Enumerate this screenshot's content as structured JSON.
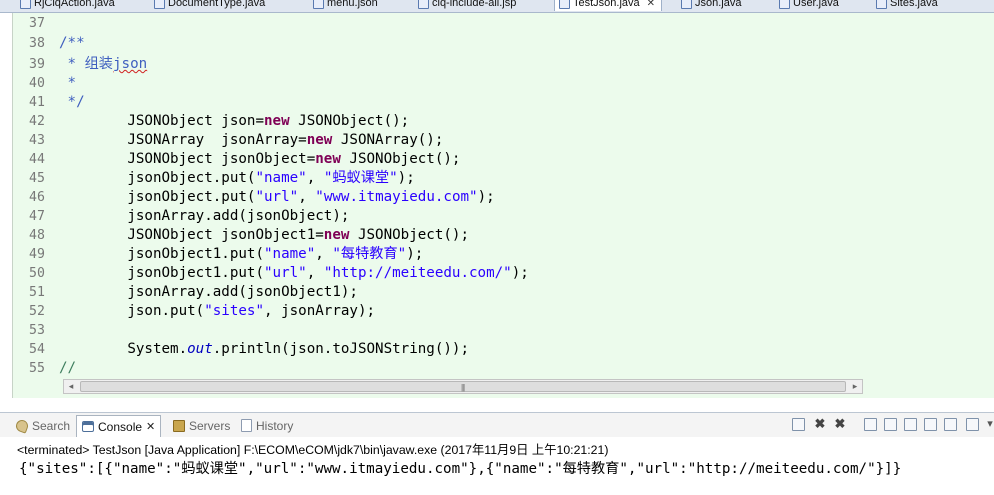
{
  "editor_tabs": [
    {
      "label": "RjCiqAction.java",
      "active": false
    },
    {
      "label": "DocumentType.java",
      "active": false
    },
    {
      "label": "menu.json",
      "active": false
    },
    {
      "label": "ciq-include-all.jsp",
      "active": false
    },
    {
      "label": "TestJson.java",
      "active": true,
      "close": "✕"
    },
    {
      "label": "Json.java",
      "active": false
    },
    {
      "label": "User.java",
      "active": false
    },
    {
      "label": "Sites.java",
      "active": false
    }
  ],
  "code": {
    "lines": [
      {
        "num": "37",
        "text": ""
      },
      {
        "num": "38",
        "text": "/**"
      },
      {
        "num": "39",
        "prefix": " * 组装",
        "word": "json"
      },
      {
        "num": "40",
        "text": " *"
      },
      {
        "num": "41",
        "text": " */"
      },
      {
        "num": "42",
        "a": "        JSONObject json=",
        "kw": "new",
        "b": " JSONObject();"
      },
      {
        "num": "43",
        "a": "        JSONArray  jsonArray=",
        "kw": "new",
        "b": " JSONArray();"
      },
      {
        "num": "44",
        "a": "        JSONObject jsonObject=",
        "kw": "new",
        "b": " JSONObject();"
      },
      {
        "num": "45",
        "a": "        jsonObject.put(",
        "s1": "\"name\"",
        "m": ", ",
        "s2": "\"蚂蚁课堂\"",
        "b": ");"
      },
      {
        "num": "46",
        "a": "        jsonObject.put(",
        "s1": "\"url\"",
        "m": ", ",
        "s2": "\"www.itmayiedu.com\"",
        "b": ");"
      },
      {
        "num": "47",
        "text": "        jsonArray.add(jsonObject);"
      },
      {
        "num": "48",
        "a": "        JSONObject jsonObject1=",
        "kw": "new",
        "b": " JSONObject();"
      },
      {
        "num": "49",
        "a": "        jsonObject1.put(",
        "s1": "\"name\"",
        "m": ", ",
        "s2": "\"每特教育\"",
        "b": ");"
      },
      {
        "num": "50",
        "a": "        jsonObject1.put(",
        "s1": "\"url\"",
        "m": ", ",
        "s2": "\"http://meiteedu.com/\"",
        "b": ");"
      },
      {
        "num": "51",
        "text": "        jsonArray.add(jsonObject1);"
      },
      {
        "num": "52",
        "a": "        json.put(",
        "s1": "\"sites\"",
        "m": ", jsonArray);"
      },
      {
        "num": "53",
        "text": ""
      },
      {
        "num": "54",
        "a": "        System.",
        "it": "out",
        "b": ".println(json.toJSONString());"
      },
      {
        "num": "55",
        "text": "//"
      }
    ]
  },
  "scrollbar": {
    "grip": "|||"
  },
  "view_tabs": [
    {
      "label": "Search",
      "icon": "search-icon",
      "active": false
    },
    {
      "label": "Console",
      "icon": "console-icon",
      "active": true,
      "close": "✕"
    },
    {
      "label": "Servers",
      "icon": "servers-icon",
      "active": false
    },
    {
      "label": "History",
      "icon": "history-icon",
      "active": false
    }
  ],
  "console": {
    "status": "<terminated> TestJson [Java Application] F:\\ECOM\\eCOM\\jdk7\\bin\\javaw.exe (2017年11月9日 上午10:21:21)",
    "output": "{\"sites\":[{\"name\":\"蚂蚁课堂\",\"url\":\"www.itmayiedu.com\"},{\"name\":\"每特教育\",\"url\":\"http://meiteedu.com/\"}]}"
  },
  "colors": {
    "editor_background": "#ecfbec",
    "keyword": "#7f0055",
    "string": "#2a00ff",
    "comment": "#3f5fbf",
    "line_number": "#787878"
  }
}
